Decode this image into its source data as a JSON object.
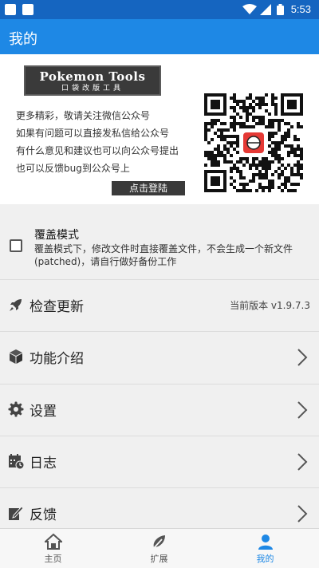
{
  "status_bar": {
    "time": "5:53"
  },
  "app_bar": {
    "title": "我的"
  },
  "info_card": {
    "logo_title": "Pokemon Tools",
    "logo_subtitle": "口袋改版工具",
    "lines": [
      "更多精彩，敬请关注微信公众号",
      "如果有问题可以直接发私信给公众号",
      "有什么意见和建议也可以向公众号提出",
      "也可以反馈bug到公众号上"
    ],
    "login_label": "点击登陆"
  },
  "overlay_mode": {
    "title": "覆盖模式",
    "description": "覆盖模式下，修改文件时直接覆盖文件，不会生成一个新文件(patched)，请自行做好备份工作",
    "checked": false
  },
  "menu": {
    "check_update": {
      "label": "检查更新",
      "version": "当前版本 v1.9.7.3",
      "icon": "rocket-icon"
    },
    "features": {
      "label": "功能介绍",
      "icon": "cube-icon"
    },
    "settings": {
      "label": "设置",
      "icon": "gear-icon"
    },
    "log": {
      "label": "日志",
      "icon": "calendar-clock-icon"
    },
    "feedback": {
      "label": "反馈",
      "icon": "edit-icon"
    }
  },
  "tabs": [
    {
      "label": "主页",
      "icon": "home-icon",
      "active": false
    },
    {
      "label": "扩展",
      "icon": "extension-icon",
      "active": false
    },
    {
      "label": "我的",
      "icon": "user-icon",
      "active": true
    }
  ],
  "colors": {
    "primary": "#1e88e5",
    "status_bar": "#1565c0",
    "accent_red": "#e53935"
  }
}
